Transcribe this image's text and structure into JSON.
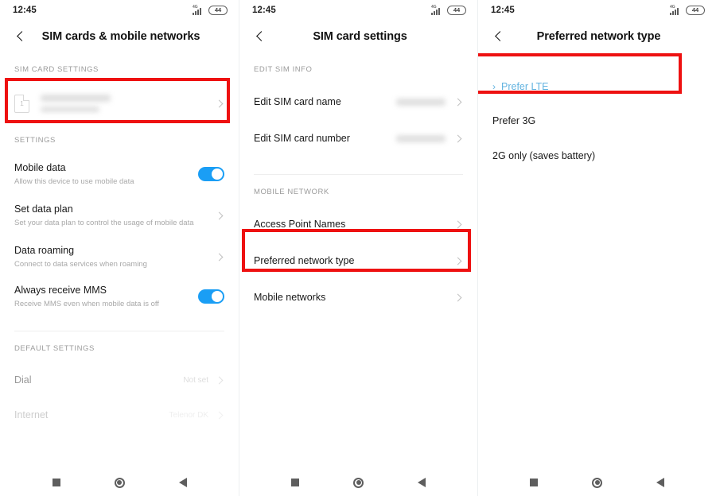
{
  "status_bar": {
    "time": "12:45",
    "network_gen": "4G",
    "battery_level": "44",
    "signal_icon": "signal-bars-icon",
    "battery_icon": "battery-icon"
  },
  "colors": {
    "highlight_red": "#ee1111",
    "toggle_on_blue": "#1a9ef5",
    "selected_blue": "#63b3e0"
  },
  "nav_bar": {
    "recents_label": "recents",
    "home_label": "home",
    "back_label": "back"
  },
  "panels": [
    {
      "title": "SIM cards & mobile networks",
      "back_icon": "back-arrow-icon",
      "sections": [
        {
          "label": "SIM CARD SETTINGS",
          "rows": [
            {
              "type": "sim",
              "sim_number": "1",
              "name_redacted": true,
              "number_redacted": true,
              "highlighted": true
            }
          ]
        },
        {
          "label": "SETTINGS",
          "rows": [
            {
              "type": "toggle",
              "title": "Mobile data",
              "subtitle": "Allow this device to use mobile data",
              "toggle_on": true
            },
            {
              "type": "link",
              "title": "Set data plan",
              "subtitle": "Set your data plan to control the usage of mobile data"
            },
            {
              "type": "link",
              "title": "Data roaming",
              "subtitle": "Connect to data services when roaming"
            },
            {
              "type": "toggle",
              "title": "Always receive MMS",
              "subtitle": "Receive MMS even when mobile data is off",
              "toggle_on": true
            }
          ]
        },
        {
          "label": "DEFAULT SETTINGS",
          "rows": [
            {
              "type": "value",
              "title": "Dial",
              "value": "Not set",
              "fade": "1"
            },
            {
              "type": "value",
              "title": "Internet",
              "value": "Telenor DK",
              "fade": "2"
            }
          ]
        }
      ]
    },
    {
      "title": "SIM card settings",
      "back_icon": "back-arrow-icon",
      "sections": [
        {
          "label": "EDIT SIM INFO",
          "rows": [
            {
              "type": "redacted-value",
              "title": "Edit SIM card name"
            },
            {
              "type": "redacted-value",
              "title": "Edit SIM card number"
            }
          ]
        },
        {
          "label": "MOBILE NETWORK",
          "rows": [
            {
              "type": "link",
              "title": "Access Point Names"
            },
            {
              "type": "link",
              "title": "Preferred network type",
              "highlighted": true
            },
            {
              "type": "link",
              "title": "Mobile networks"
            }
          ]
        }
      ]
    },
    {
      "title": "Preferred network type",
      "back_icon": "back-arrow-icon",
      "options": [
        {
          "label": "Prefer LTE",
          "selected": true,
          "marker": "›"
        },
        {
          "label": "Prefer 3G",
          "selected": false
        },
        {
          "label": "2G only (saves battery)",
          "selected": false
        }
      ]
    }
  ]
}
